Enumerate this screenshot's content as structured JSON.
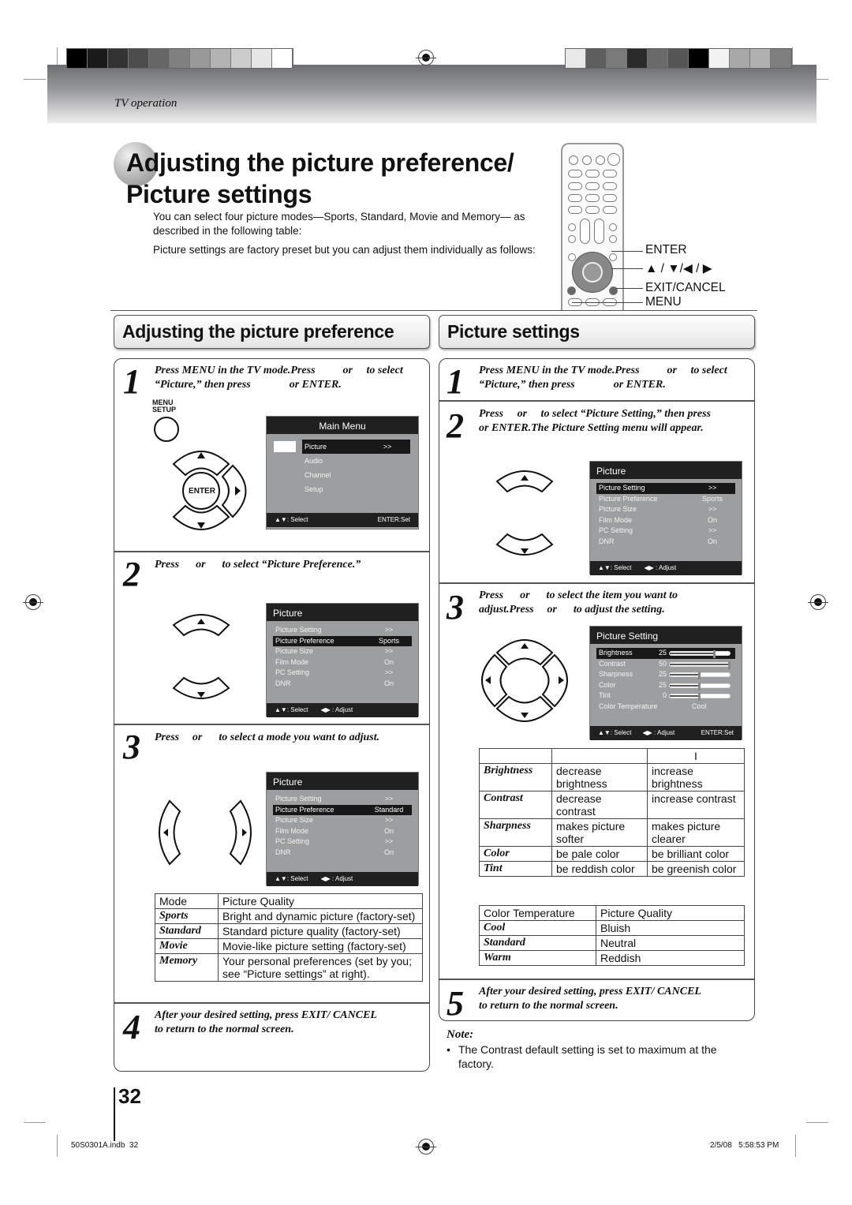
{
  "header": {
    "section_label": "TV operation",
    "swatches_left": [
      "#000000",
      "#1a1a1a",
      "#333333",
      "#4d4d4d",
      "#666666",
      "#808080",
      "#999999",
      "#b3b3b3",
      "#cccccc",
      "#e6e6e6",
      "#ffffff"
    ],
    "swatches_right": [
      "#e8e8e8",
      "#5e5e5e",
      "#7a7a7a",
      "#2a2a2a",
      "#6a6a6a",
      "#555555",
      "#000000",
      "#f2f2f2",
      "#a8a8a8",
      "#b0b0b0",
      "#7e7e7e"
    ]
  },
  "page": {
    "title_line1": "Adjusting the picture preference/",
    "title_line2": "Picture settings",
    "intro_p1": "You can select four picture modes—Sports, Standard, Movie and Memory— as described in the following table:",
    "intro_p2": "Picture settings are factory preset but you can adjust them individually as follows:"
  },
  "remote": {
    "labels": {
      "enter": "ENTER",
      "arrows": "▲ / ▼/◀ / ▶",
      "exit": "EXIT/CANCEL",
      "menu": "MENU"
    }
  },
  "left": {
    "heading": "Adjusting the picture preference",
    "steps": [
      {
        "num": "1",
        "text": "Press MENU in the TV mode.Press          or     to select “Picture,” then press              or ENTER."
      },
      {
        "num": "2",
        "text": "Press      or      to select “Picture Preference.”"
      },
      {
        "num": "3",
        "text": "Press     or      to select a mode you want to adjust."
      },
      {
        "num": "4",
        "text": "After your desired setting, press EXIT/ CANCEL to return to the normal screen."
      }
    ],
    "menu_setup_label_1": "MENU",
    "menu_setup_label_2": "SETUP",
    "enter_label": "ENTER",
    "main_menu": {
      "title": "Main Menu",
      "items": [
        {
          "label": "Picture",
          "value": ">>",
          "selected": true
        },
        {
          "label": "Audio",
          "value": "",
          "selected": false
        },
        {
          "label": "Channel",
          "value": "",
          "selected": false
        },
        {
          "label": "Setup",
          "value": "",
          "selected": false
        }
      ],
      "footer_left": "▲▼: Select",
      "footer_right": "ENTER:Set"
    },
    "picture_menu_a": {
      "title": "Picture",
      "items": [
        {
          "label": "Picture Setting",
          "value": ">>",
          "selected": false
        },
        {
          "label": "Picture Preference",
          "value": "Sports",
          "selected": true
        },
        {
          "label": "Picture Size",
          "value": ">>",
          "selected": false
        },
        {
          "label": "Film Mode",
          "value": "On",
          "selected": false
        },
        {
          "label": "PC Setting",
          "value": ">>",
          "selected": false
        },
        {
          "label": "DNR",
          "value": "On",
          "selected": false
        }
      ],
      "footer_left": "▲▼: Select",
      "footer_mid": "◀▶ : Adjust"
    },
    "picture_menu_b": {
      "title": "Picture",
      "items": [
        {
          "label": "Picture Setting",
          "value": ">>",
          "selected": false
        },
        {
          "label": "Picture Preference",
          "value": "Standard",
          "selected": true
        },
        {
          "label": "Picture Size",
          "value": ">>",
          "selected": false
        },
        {
          "label": "Film Mode",
          "value": "On",
          "selected": false
        },
        {
          "label": "PC Setting",
          "value": ">>",
          "selected": false
        },
        {
          "label": "DNR",
          "value": "On",
          "selected": false
        }
      ],
      "footer_left": "▲▼: Select",
      "footer_mid": "◀▶ : Adjust"
    },
    "mode_table": {
      "headers": [
        "Mode",
        "Picture Quality"
      ],
      "rows": [
        [
          "Sports",
          "Bright and dynamic picture (factory-set)"
        ],
        [
          "Standard",
          "Standard picture quality (factory-set)"
        ],
        [
          "Movie",
          "Movie-like picture setting (factory-set)"
        ],
        [
          "Memory",
          "Your personal preferences (set by you; see “Picture settings” at right)."
        ]
      ]
    }
  },
  "right": {
    "heading": "Picture settings",
    "steps": [
      {
        "num": "1",
        "text": "Press MENU in the TV mode.Press          or     to select “Picture,” then press              or ENTER."
      },
      {
        "num": "2",
        "text": "Press     or     to select “Picture Setting,” then press     or ENTER.The Picture Setting menu will appear."
      },
      {
        "num": "3",
        "text": "Press      or      to select the item you want to adjust.Press     or      to adjust the setting."
      },
      {
        "num": "5",
        "text": "After your desired setting, press EXIT/ CANCEL to return to the normal screen."
      }
    ],
    "picture_menu": {
      "title": "Picture",
      "items": [
        {
          "label": "Picture Setting",
          "value": ">>",
          "selected": true
        },
        {
          "label": "Picture Preference",
          "value": "Sports",
          "selected": false
        },
        {
          "label": "Picture Size",
          "value": ">>",
          "selected": false
        },
        {
          "label": "Film Mode",
          "value": "On",
          "selected": false
        },
        {
          "label": "PC Setting",
          "value": ">>",
          "selected": false
        },
        {
          "label": "DNR",
          "value": "On",
          "selected": false
        }
      ],
      "footer_left": "▲▼: Select",
      "footer_mid": "◀▶ : Adjust"
    },
    "setting_menu": {
      "title": "Picture Setting",
      "sliders": [
        {
          "label": "Brightness",
          "value": "25",
          "fraction": 0.75,
          "selected": true
        },
        {
          "label": "Contrast",
          "value": "50",
          "fraction": 1.0,
          "selected": false
        },
        {
          "label": "Sharpness",
          "value": "25",
          "fraction": 0.5,
          "selected": false
        },
        {
          "label": "Color",
          "value": "25",
          "fraction": 0.5,
          "selected": false
        },
        {
          "label": "Tint",
          "value": "0",
          "fraction": 0.5,
          "selected": false
        }
      ],
      "color_temp_label": "Color Temperature",
      "color_temp_value": "Cool",
      "footer_left": "▲▼: Select",
      "footer_mid": "◀▶ : Adjust",
      "footer_right": "ENTER:Set"
    },
    "adjust_table": {
      "headers": [
        "",
        "",
        "I"
      ],
      "rows": [
        [
          "Brightness",
          "decrease brightness",
          "increase brightness"
        ],
        [
          "Contrast",
          "decrease contrast",
          "increase contrast"
        ],
        [
          "Sharpness",
          "makes picture softer",
          "makes picture clearer"
        ],
        [
          "Color",
          "be pale color",
          "be brilliant color"
        ],
        [
          "Tint",
          "be reddish color",
          "be greenish color"
        ]
      ]
    },
    "temp_table": {
      "headers": [
        "Color Temperature",
        "Picture Quality"
      ],
      "rows": [
        [
          "Cool",
          "Bluish"
        ],
        [
          "Standard",
          "Neutral"
        ],
        [
          "Warm",
          "Reddish"
        ]
      ]
    },
    "note_label": "Note:",
    "note_text": "The Contrast default setting is set to maximum at the factory."
  },
  "footer": {
    "page_number": "32",
    "file_info": "50S0301A.indb  32",
    "timestamp": "2/5/08   5:58:53 PM"
  }
}
